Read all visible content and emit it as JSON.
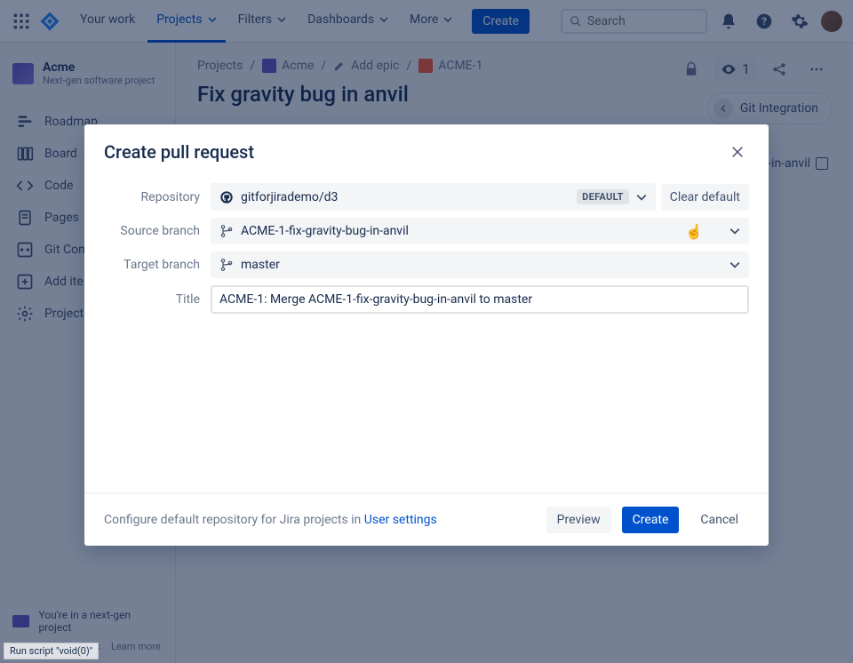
{
  "topnav": {
    "your_work": "Your work",
    "projects": "Projects",
    "filters": "Filters",
    "dashboards": "Dashboards",
    "more": "More",
    "create": "Create",
    "search_placeholder": "Search"
  },
  "sidebar": {
    "project_name": "Acme",
    "project_type": "Next-gen software project",
    "items": [
      {
        "label": "Roadmap"
      },
      {
        "label": "Board"
      },
      {
        "label": "Code"
      },
      {
        "label": "Pages"
      },
      {
        "label": "Git Com"
      },
      {
        "label": "Add ite"
      },
      {
        "label": "Project"
      }
    ],
    "footer_banner": "You're in a next-gen project",
    "footer_feedback": "Give feedback",
    "footer_learn": "Learn more"
  },
  "breadcrumb": {
    "projects": "Projects",
    "project": "Acme",
    "add_epic": "Add epic",
    "issue_key": "ACME-1"
  },
  "issue": {
    "title": "Fix gravity bug in anvil",
    "watch_count": "1",
    "git_integration": "Git Integration"
  },
  "bg_hint": "-in-anvil",
  "modal": {
    "title": "Create pull request",
    "labels": {
      "repository": "Repository",
      "source_branch": "Source branch",
      "target_branch": "Target branch",
      "title": "Title"
    },
    "repository": "gitforjirademo/d3",
    "default_badge": "DEFAULT",
    "clear_default": "Clear default",
    "source_branch": "ACME-1-fix-gravity-bug-in-anvil",
    "target_branch": "master",
    "title_value": "ACME-1: Merge ACME-1-fix-gravity-bug-in-anvil to master",
    "footer_hint_prefix": "Configure default repository for Jira projects in ",
    "footer_hint_link": "User settings",
    "preview": "Preview",
    "create": "Create",
    "cancel": "Cancel"
  },
  "status_bar": "Run script \"void(0)\""
}
